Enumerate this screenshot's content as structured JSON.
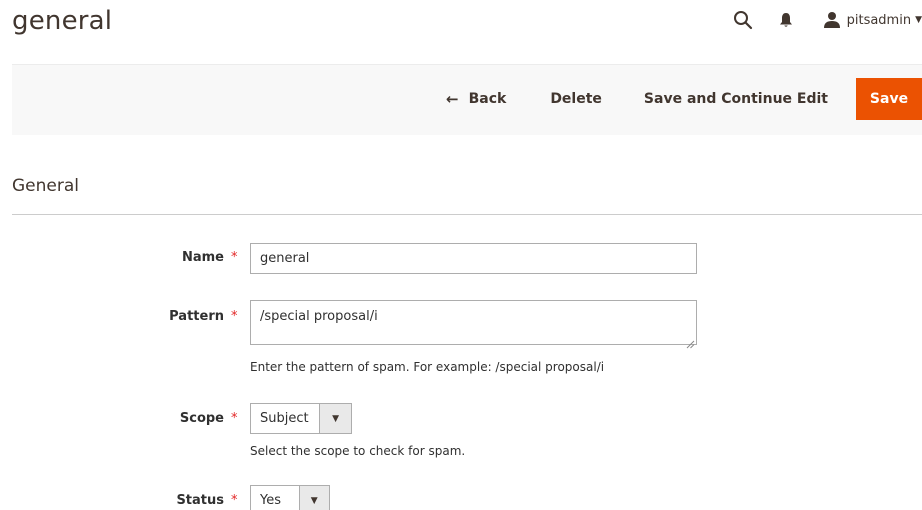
{
  "page": {
    "title": "general"
  },
  "header": {
    "search_icon": "search-icon",
    "notifications_icon": "bell-icon",
    "user_icon": "user-icon",
    "username": "pitsadmin"
  },
  "toolbar": {
    "back_label": "Back",
    "delete_label": "Delete",
    "save_continue_label": "Save and Continue Edit",
    "save_label": "Save"
  },
  "section": {
    "title": "General"
  },
  "form": {
    "name": {
      "label": "Name",
      "required_mark": "*",
      "value": "general"
    },
    "pattern": {
      "label": "Pattern",
      "required_mark": "*",
      "value": "/special proposal/i",
      "note": "Enter the pattern of spam. For example: /special proposal/i"
    },
    "scope": {
      "label": "Scope",
      "required_mark": "*",
      "value": "Subject",
      "note": "Select the scope to check for spam."
    },
    "status": {
      "label": "Status",
      "required_mark": "*",
      "value": "Yes"
    }
  },
  "colors": {
    "accent": "#eb5202",
    "required": "#e22626",
    "toolbar_bg": "#f8f8f8"
  }
}
